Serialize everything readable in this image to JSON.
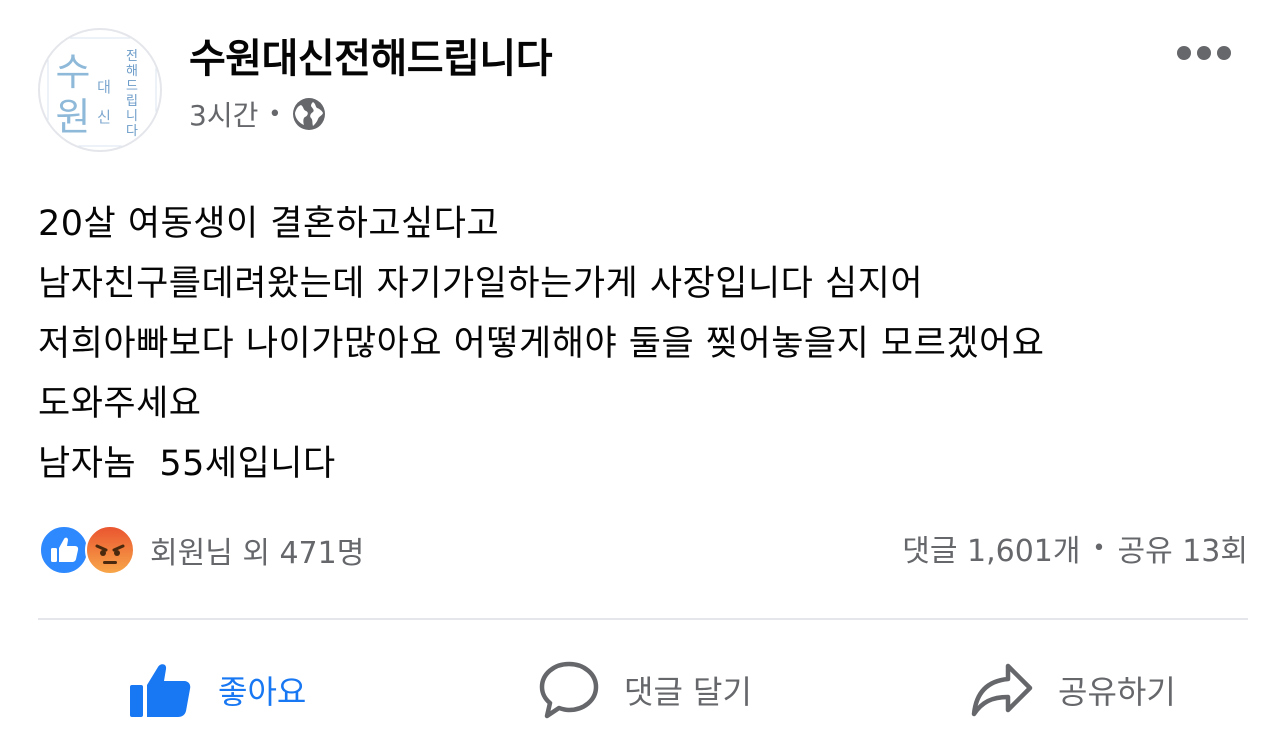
{
  "header": {
    "page_name": "수원대신전해드립니다",
    "time": "3시간",
    "separator": "•",
    "privacy_icon": "globe-icon",
    "more_icon": "more-horizontal-icon",
    "avatar": {
      "big_chars": "수원",
      "side_chars": "대신",
      "vertical_text": "전해드립니다"
    }
  },
  "post": {
    "lines": [
      "20살 여동생이 결혼하고싶다고",
      "남자친구를데려왔는데 자기가일하는가게 사장입니다 심지어",
      "저희아빠보다 나이가많아요 어떻게해야 둘을 찢어놓을지 모르겠어요",
      "도와주세요",
      "남자놈  55세입니다"
    ]
  },
  "reactions": {
    "icons": [
      "like-reaction-icon",
      "angry-reaction-icon"
    ],
    "label": "회원님 외 471명"
  },
  "stats": {
    "comments": "댓글 1,601개",
    "separator": "•",
    "shares": "공유 13회"
  },
  "actions": {
    "like": "좋아요",
    "comment": "댓글 달기",
    "share": "공유하기"
  },
  "colors": {
    "accent": "#1877f2",
    "secondary_text": "#65676b",
    "primary_text": "#050505",
    "angry": "#f7714c",
    "divider": "#e4e6eb",
    "avatar_letter": "#8fb9d9"
  }
}
